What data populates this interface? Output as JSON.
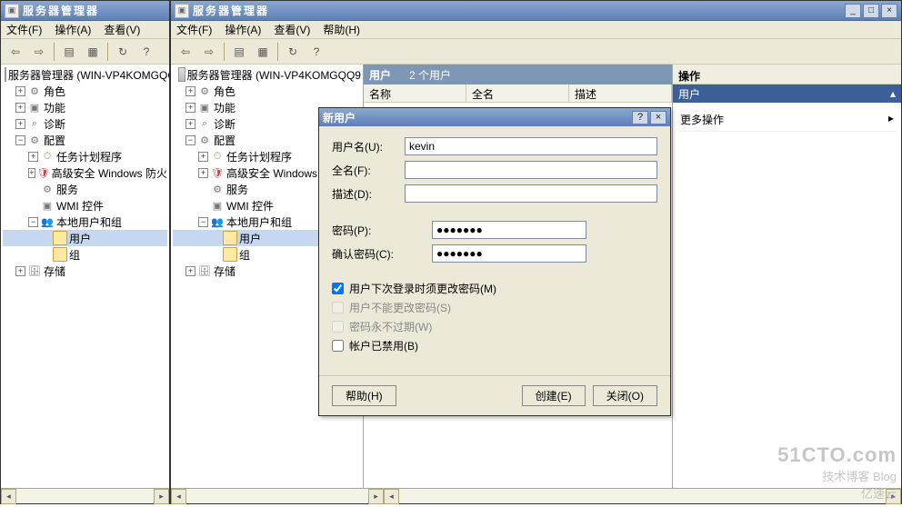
{
  "back_window": {
    "title": "服务器管理器",
    "menus": [
      "文件(F)",
      "操作(A)",
      "查看(V)"
    ],
    "tree": {
      "root": "服务器管理器 (WIN-VP4KOMGQQ",
      "roles": "角色",
      "features": "功能",
      "diag": "诊断",
      "config": "配置",
      "task": "任务计划程序",
      "firewall": "高级安全 Windows 防火",
      "services": "服务",
      "wmi": "WMI 控件",
      "localusers": "本地用户和组",
      "users": "用户",
      "groups": "组",
      "storage": "存储"
    }
  },
  "front_window": {
    "title": "服务器管理器",
    "menus": [
      "文件(F)",
      "操作(A)",
      "查看(V)",
      "帮助(H)"
    ],
    "tree": {
      "root": "服务器管理器 (WIN-VP4KOMGQQ9",
      "roles": "角色",
      "features": "功能",
      "diag": "诊断",
      "config": "配置",
      "task": "任务计划程序",
      "firewall": "高级安全 Windows",
      "services": "服务",
      "wmi": "WMI 控件",
      "localusers": "本地用户和组",
      "users": "用户",
      "groups": "组",
      "storage": "存储"
    },
    "list": {
      "header_title": "用户",
      "header_count": "2 个用户",
      "cols": [
        "名称",
        "全名",
        "描述"
      ]
    },
    "actions": {
      "title": "操作",
      "section": "用户",
      "more": "更多操作",
      "arrow": "▸",
      "up": "▴"
    },
    "win_btns": {
      "min": "_",
      "max": "□",
      "close": "×"
    }
  },
  "dialog": {
    "title": "新用户",
    "help": "?",
    "close": "×",
    "fields": {
      "username_label": "用户名(U):",
      "username_value": "kevin",
      "fullname_label": "全名(F):",
      "fullname_value": "",
      "desc_label": "描述(D):",
      "desc_value": "",
      "pw_label": "密码(P):",
      "pw_value": "●●●●●●●",
      "cpw_label": "确认密码(C):",
      "cpw_value": "●●●●●●●"
    },
    "checks": {
      "must_change": "用户下次登录时须更改密码(M)",
      "cannot_change": "用户不能更改密码(S)",
      "never_expire": "密码永不过期(W)",
      "disabled": "帐户已禁用(B)"
    },
    "buttons": {
      "help": "帮助(H)",
      "create": "创建(E)",
      "close_btn": "关闭(O)"
    }
  },
  "watermark": {
    "line1": "51CTO.com",
    "line2": "技术博客  Blog",
    "line3": "亿速云"
  }
}
